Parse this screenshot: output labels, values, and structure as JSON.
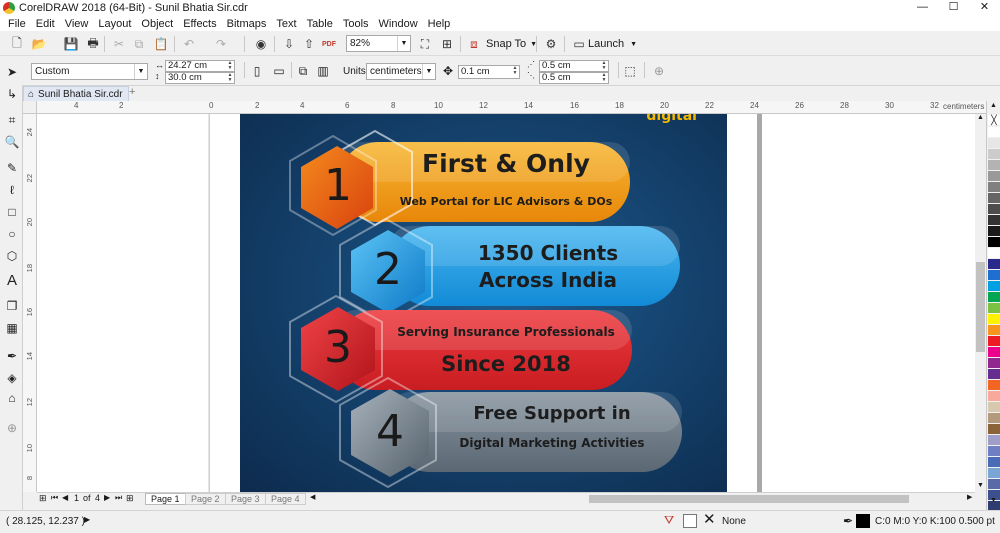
{
  "window": {
    "title": "CorelDRAW 2018 (64-Bit) - Sunil Bhatia Sir.cdr",
    "min": "—",
    "max": "☐",
    "close": "✕"
  },
  "menu": [
    "File",
    "Edit",
    "View",
    "Layout",
    "Object",
    "Effects",
    "Bitmaps",
    "Text",
    "Table",
    "Tools",
    "Window",
    "Help"
  ],
  "toolbar": {
    "zoom": "82%",
    "snap_to": "Snap To",
    "launch": "Launch"
  },
  "propbar": {
    "page_preset": "Custom",
    "width": "24.27 cm",
    "height": "30.0 cm",
    "units_label": "Units:",
    "units": "centimeters",
    "nudge": "0.1 cm",
    "dup_x": "0.5 cm",
    "dup_y": "0.5 cm"
  },
  "doc_tab": "Sunil Bhatia Sir.cdr",
  "ruler": {
    "h_labels": [
      "4",
      "2",
      "0",
      "2",
      "4",
      "6",
      "8",
      "10",
      "12",
      "14",
      "16",
      "18",
      "20",
      "22",
      "24",
      "26",
      "28",
      "30",
      "32"
    ],
    "unit": "centimeters",
    "v_labels": [
      "24",
      "22",
      "20",
      "18",
      "16",
      "14",
      "12",
      "10",
      "8",
      "6"
    ]
  },
  "poster": {
    "top_partial": "digital",
    "items": [
      {
        "num": "1",
        "line1": "First & Only",
        "line2": "Web Portal for LIC Advisors & DOs",
        "color": "#f29a0f",
        "dark": "#e0530f"
      },
      {
        "num": "2",
        "line1": "1350 Clients",
        "line2": "Across India",
        "color": "#1e9fe6",
        "dark": "#0b74c4"
      },
      {
        "num": "3",
        "line1": "Serving Insurance Professionals",
        "line2": "Since 2018",
        "color": "#e0262a",
        "dark": "#b5161b"
      },
      {
        "num": "4",
        "line1": "Free Support in",
        "line2": "Digital Marketing Activities",
        "color": "#6b7a86",
        "dark": "#4c5963"
      }
    ]
  },
  "pagebar": {
    "current": "1",
    "of": "of",
    "total": "4",
    "pages": [
      "Page 1",
      "Page 2",
      "Page 3",
      "Page 4"
    ]
  },
  "status": {
    "coords": "( 28.125, 12.237 )",
    "fill": "None",
    "outline": "C:0 M:0 Y:0 K:100  0.500 pt"
  },
  "palette": [
    "#ffffff",
    "#e6e6e6",
    "#cccccc",
    "#b3b3b3",
    "#999999",
    "#808080",
    "#666666",
    "#4d4d4d",
    "#333333",
    "#1a1a1a",
    "#000000",
    "#ffffff",
    "#2a2a8c",
    "#1f6fd0",
    "#00a0e3",
    "#00a651",
    "#7cc242",
    "#fff200",
    "#f7941d",
    "#ed1c24",
    "#ec008c",
    "#92278f",
    "#662d91",
    "#f26522",
    "#f9a89c",
    "#d7c8b0",
    "#b39a7c",
    "#8c6239",
    "#9e9ec9",
    "#6f7fc4",
    "#4a6bb5",
    "#7aa6d6",
    "#5a6aa8",
    "#3c4f8f",
    "#2e3c6f"
  ]
}
